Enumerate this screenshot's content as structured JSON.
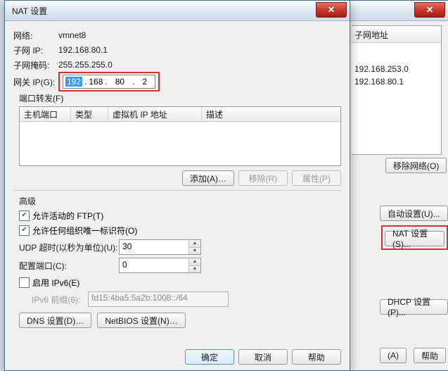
{
  "back_window": {
    "title": "",
    "list_header": "子网地址",
    "list_items": [
      "192.168.253.0",
      "192.168.80.1"
    ],
    "remove_net": "移除网络(O)",
    "auto_set": "自动设置(U)...",
    "nat_set": "NAT 设置(S)...",
    "dhcp_set": "DHCP 设置(P)...",
    "btn_a": "(A)",
    "help": "帮助"
  },
  "front_window": {
    "title": "NAT 设置",
    "net_lbl": "网络:",
    "net_val": "vmnet8",
    "subnetip_lbl": "子网 IP:",
    "subnetip_val": "192.168.80.1",
    "mask_lbl": "子网掩码:",
    "mask_val": "255.255.255.0",
    "gw_lbl": "网关 IP(G):",
    "gw_octets": [
      "192",
      "168",
      "80",
      "2"
    ],
    "portfwd_title": "端口转发(F)",
    "cols": {
      "host": "主机端口",
      "type": "类型",
      "vmip": "虚拟机 IP 地址",
      "desc": "描述"
    },
    "add": "添加(A)…",
    "remove": "移除(R)",
    "props": "属性(P)",
    "adv_title": "高级",
    "allow_ftp": "允许活动的 FTP(T)",
    "allow_oui": "允许任何组织唯一标识符(O)",
    "udp_lbl": "UDP 超时(以秒为单位)(U):",
    "udp_val": "30",
    "cfgport_lbl": "配置端口(C):",
    "cfgport_val": "0",
    "ipv6_enable": "启用 IPv6(E)",
    "ipv6_prefix_lbl": "IPv6 前缀(6):",
    "ipv6_prefix_val": "fd15:4ba5:5a2b:1008::/64",
    "dns_btn": "DNS 设置(D)…",
    "netbios_btn": "NetBIOS 设置(N)…",
    "ok": "确定",
    "cancel": "取消",
    "help": "帮助"
  }
}
